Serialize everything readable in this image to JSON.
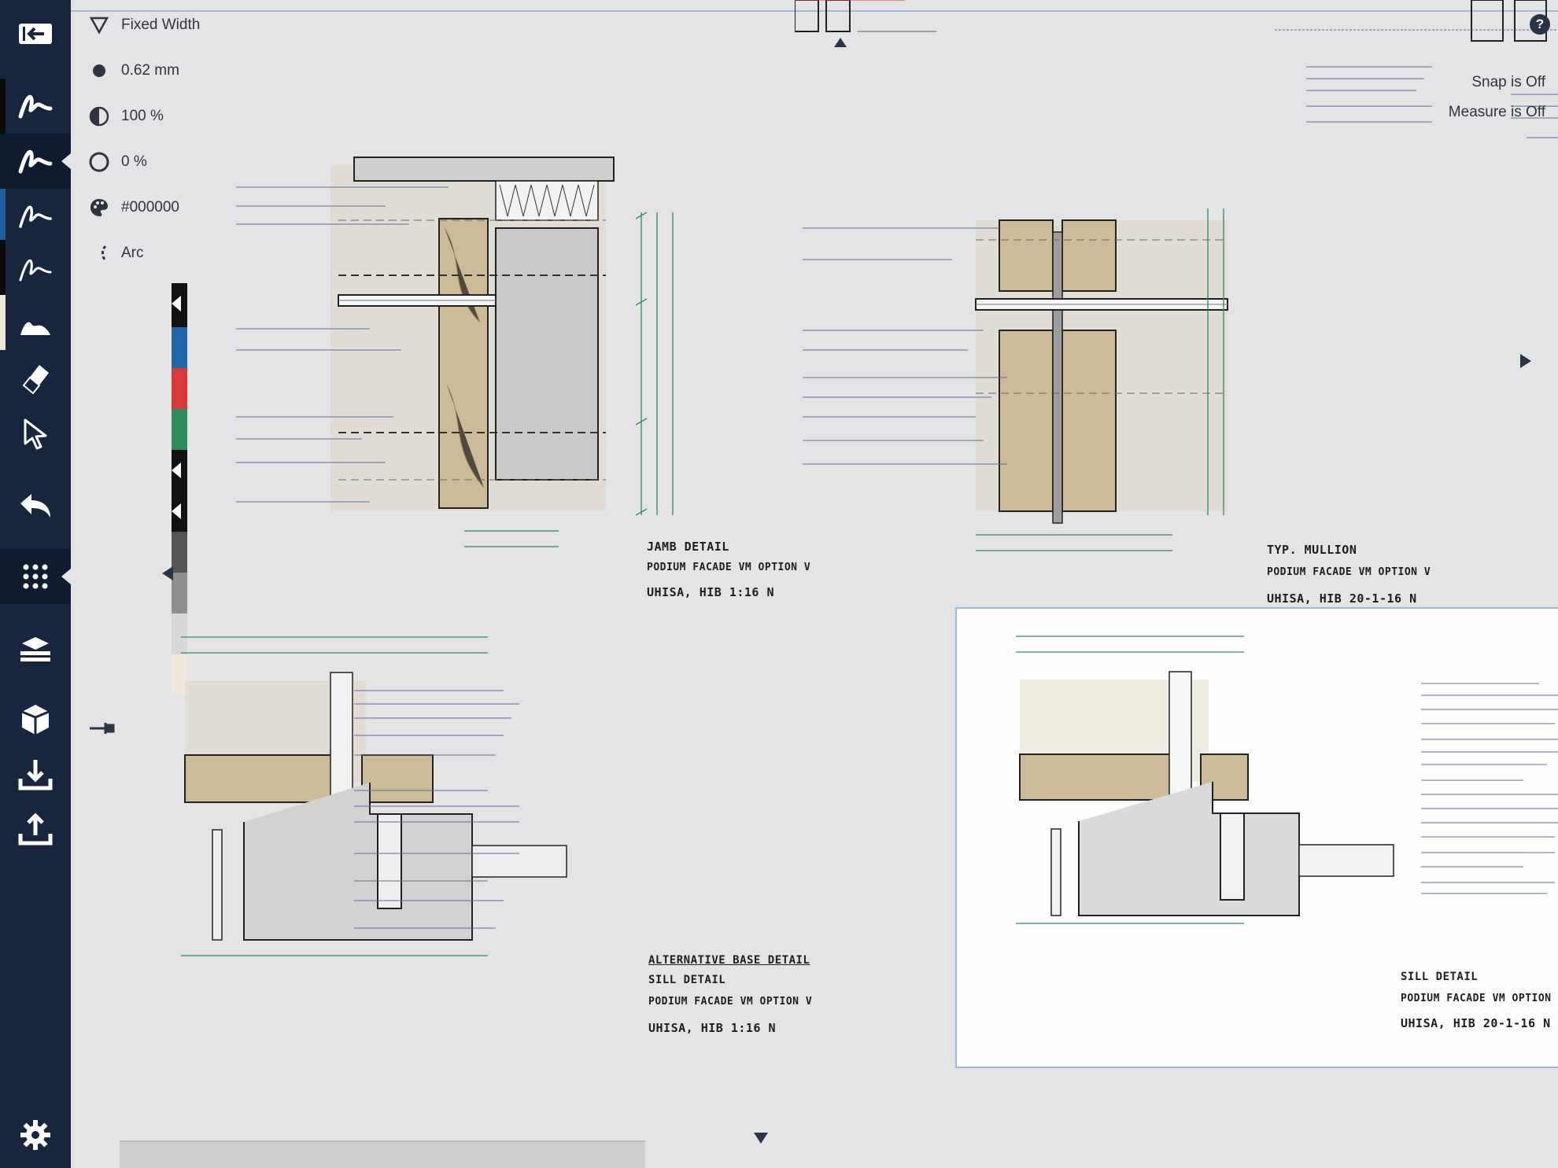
{
  "pen": {
    "mode_label": "Fixed Width",
    "width_label": "0.62 mm",
    "opacity_label": "100 %",
    "smoothing_label": "0 %",
    "color_label": "#000000",
    "shape_label": "Arc"
  },
  "status": {
    "snap": "Snap is Off",
    "measure": "Measure is Off"
  },
  "help_label": "?",
  "colors": {
    "toolbar_bg": "#17253f",
    "accent_blue": "#1f5e9e",
    "swatches": [
      "#111111",
      "#2166a8",
      "#d63a3a",
      "#2c8c5a",
      "#111111",
      "#111111",
      "#555555",
      "#8e8e8e",
      "#d8d8d8",
      "#efe6dc"
    ]
  },
  "tools": [
    {
      "name": "collapse-toolbar",
      "icon": "collapse-panel-icon"
    },
    {
      "name": "pen-1",
      "icon": "pen-stroke-icon"
    },
    {
      "name": "pen-2",
      "icon": "pen-stroke-icon"
    },
    {
      "name": "pen-3",
      "icon": "pen-stroke-icon"
    },
    {
      "name": "pen-4",
      "icon": "pen-stroke-icon"
    },
    {
      "name": "fill",
      "icon": "fill-brush-icon"
    },
    {
      "name": "eraser",
      "icon": "eraser-icon"
    },
    {
      "name": "select",
      "icon": "select-arrow-icon"
    },
    {
      "name": "undo",
      "icon": "undo-icon"
    },
    {
      "name": "grid",
      "icon": "grid-icon"
    },
    {
      "name": "layers",
      "icon": "layers-icon"
    },
    {
      "name": "model",
      "icon": "cube-icon"
    },
    {
      "name": "import",
      "icon": "import-icon"
    },
    {
      "name": "export",
      "icon": "export-icon"
    },
    {
      "name": "settings",
      "icon": "gear-icon"
    }
  ],
  "drawings": {
    "jamb": {
      "l1": "JAMB DETAIL",
      "l2": "PODIUM FACADE  VM OPTION  V",
      "l3": "UHISA, HIB          1:16  N"
    },
    "mullion": {
      "l1": "TYP. MULLION",
      "l2": "PODIUM FACADE  VM OPTION  V",
      "l3": "UHISA, HIB     20-1-16  N"
    },
    "alt_base": {
      "l0": "ALTERNATIVE BASE DETAIL",
      "l1": "SILL DETAIL",
      "l2": "PODIUM FACADE  VM OPTION  V",
      "l3": "UHISA, HIB          1:16  N"
    },
    "sill": {
      "l1": "SILL DETAIL",
      "l2": "PODIUM FACADE  VM OPTION  V",
      "l3": "UHISA, HIB     20-1-16  N"
    }
  }
}
